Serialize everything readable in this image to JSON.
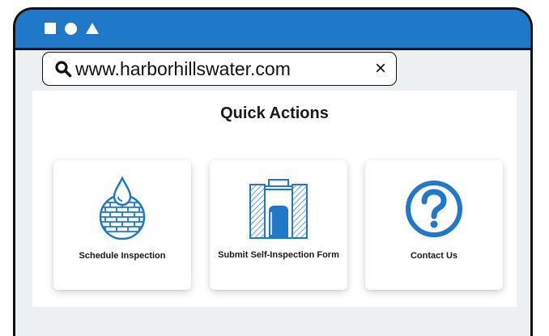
{
  "browser": {
    "url": "www.harborhillswater.com",
    "clear_glyph": "×",
    "titlebar_color": "#1f78c8",
    "icons": [
      "square-icon",
      "circle-icon",
      "triangle-icon",
      "search-icon",
      "close-icon"
    ]
  },
  "page": {
    "title": "Quick Actions",
    "accent_color": "#1f78c8",
    "cards": [
      {
        "label": "Schedule Inspection",
        "icon": "water-drop-grid-icon"
      },
      {
        "label": "Submit Self-Inspection Form",
        "icon": "water-tank-icon"
      },
      {
        "label": "Contact Us",
        "icon": "question-mark-icon"
      }
    ]
  }
}
